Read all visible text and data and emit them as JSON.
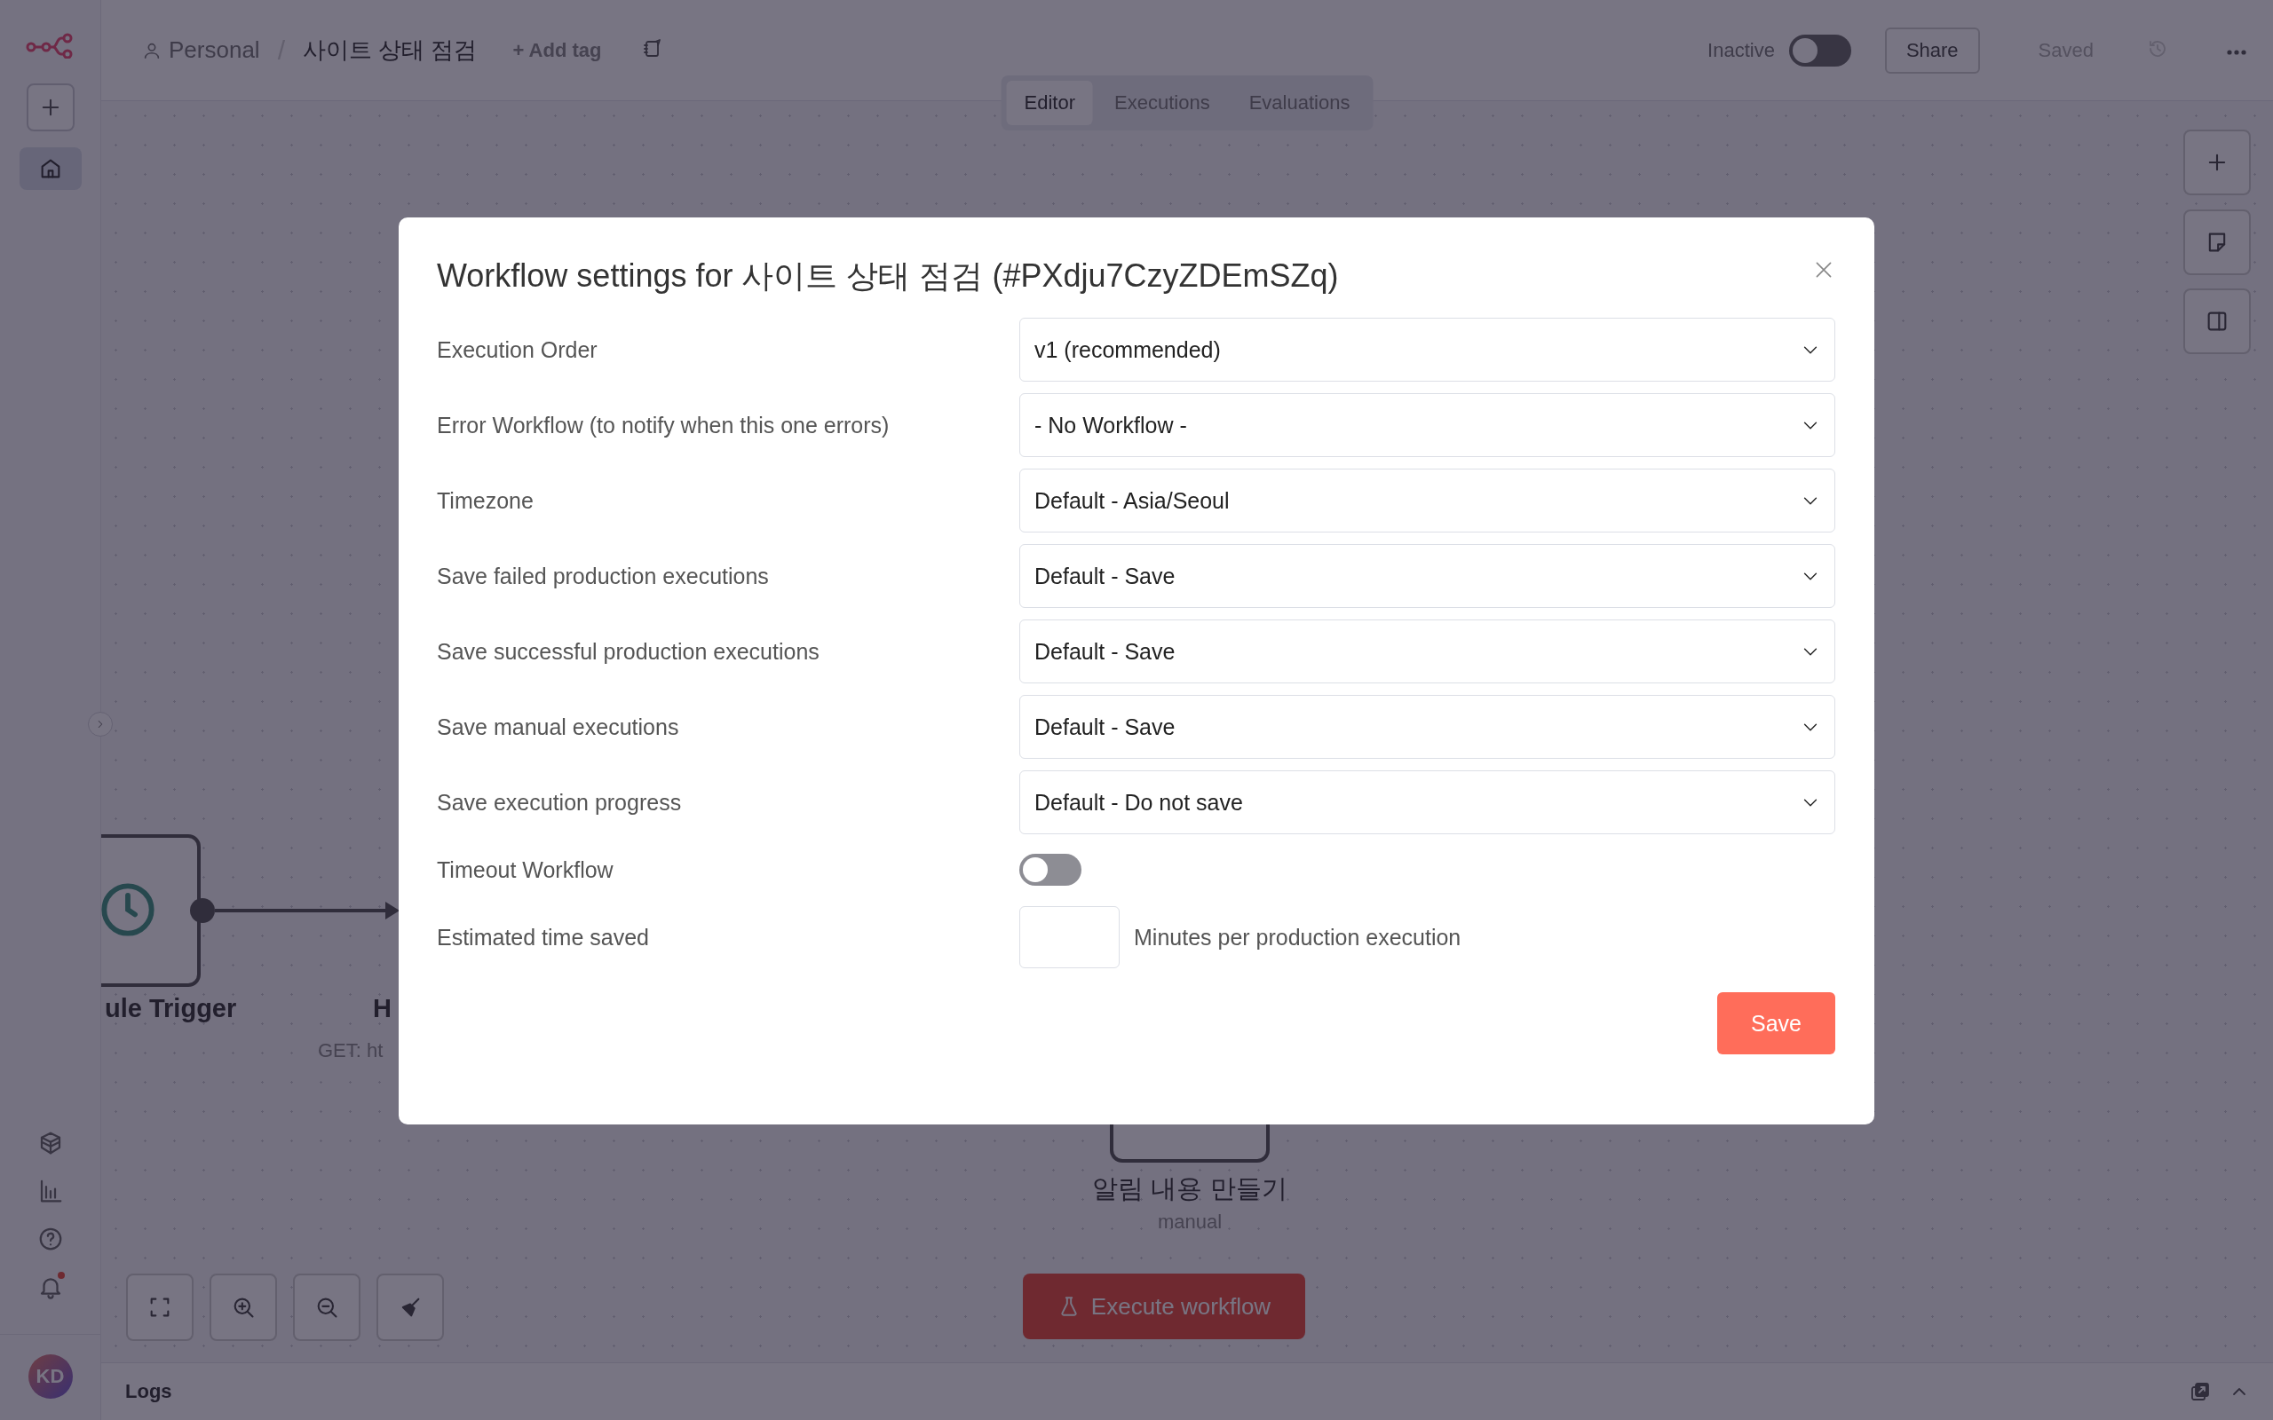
{
  "sidebar": {
    "items": [
      {
        "kind": "home",
        "selected": true
      }
    ],
    "bottom_items": [
      {
        "kind": "templates",
        "unread": false
      },
      {
        "kind": "insights",
        "unread": false
      },
      {
        "kind": "help",
        "unread": false
      },
      {
        "kind": "notifications",
        "unread": true
      }
    ],
    "avatar": "KD"
  },
  "header": {
    "project": "Personal",
    "separator": "/",
    "workflow": "사이트 상태 점검",
    "add_tag": "+ Add tag",
    "status": {
      "label": "Inactive",
      "on": false
    },
    "share": "Share",
    "save_state": "Saved"
  },
  "tabs": [
    {
      "label": "Editor",
      "selected": true
    },
    {
      "label": "Executions",
      "selected": false
    },
    {
      "label": "Evaluations",
      "selected": false
    }
  ],
  "canvas": {
    "nodes": [
      {
        "kind": "trigger",
        "name": "ule Trigger"
      },
      {
        "kind": "http",
        "name": "H",
        "subtitle": "GET: ht"
      },
      {
        "kind": "manual",
        "name": "알림 내용 만들기",
        "subtitle": "manual"
      }
    ],
    "execute_button": "Execute workflow"
  },
  "logs": {
    "title": "Logs"
  },
  "modal": {
    "title": "Workflow settings for 사이트 상태 점검 (#PXdju7CzyZDEmSZq)",
    "fields": [
      {
        "kind": "select",
        "label": "Execution Order",
        "value": "v1 (recommended)"
      },
      {
        "kind": "select",
        "label": "Error Workflow (to notify when this one errors)",
        "value": "- No Workflow -"
      },
      {
        "kind": "select",
        "label": "Timezone",
        "value": "Default - Asia/Seoul"
      },
      {
        "kind": "select",
        "label": "Save failed production executions",
        "value": "Default - Save"
      },
      {
        "kind": "select",
        "label": "Save successful production executions",
        "value": "Default - Save"
      },
      {
        "kind": "select",
        "label": "Save manual executions",
        "value": "Default - Save"
      },
      {
        "kind": "select",
        "label": "Save execution progress",
        "value": "Default - Do not save"
      },
      {
        "kind": "toggle",
        "label": "Timeout Workflow",
        "on": false
      },
      {
        "kind": "number",
        "label": "Estimated time saved",
        "suffix": "Minutes per production execution"
      }
    ],
    "save_button": "Save"
  }
}
